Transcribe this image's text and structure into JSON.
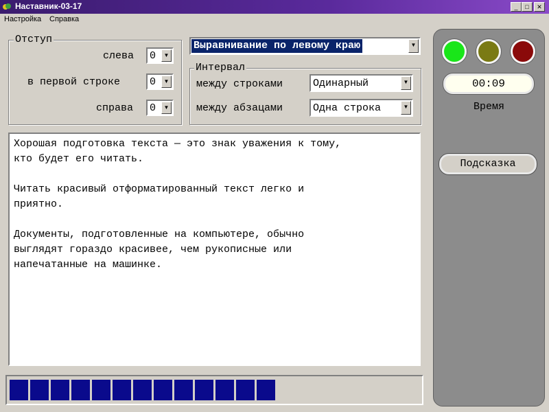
{
  "window": {
    "title": "Наставник-03-17"
  },
  "menu": [
    "Настройка",
    "Справка"
  ],
  "indent": {
    "legend": "Отступ",
    "left": {
      "label": "слева",
      "value": "0"
    },
    "first_line": {
      "label": "в первой строке",
      "value": "0"
    },
    "right": {
      "label": "справа",
      "value": "0"
    }
  },
  "alignment": {
    "value": "Выравнивание по левому краю"
  },
  "interval": {
    "legend": "Интервал",
    "lines": {
      "label": "между строками",
      "value": "Одинарный"
    },
    "paragraphs": {
      "label": "между абзацами",
      "value": "Одна строка"
    }
  },
  "text": {
    "paragraphs": [
      "Хорошая подготовка текста — это знак уважения к тому,\nкто будет его читать.",
      "Читать красивый отформатированный текст легко и\nприятно.",
      "Документы, подготовленные на компьютере, обычно\nвыглядят гораздо красивее, чем рукописные или\nнапечатанные на машинке."
    ]
  },
  "progress": {
    "filled_segments": 13
  },
  "panel": {
    "lights": [
      {
        "name": "green",
        "color": "#19e619"
      },
      {
        "name": "olive",
        "color": "#7a7a14"
      },
      {
        "name": "red",
        "color": "#8a0a0a"
      }
    ],
    "timer": "00:09",
    "time_label": "Время",
    "hint_button": "Подсказка"
  }
}
